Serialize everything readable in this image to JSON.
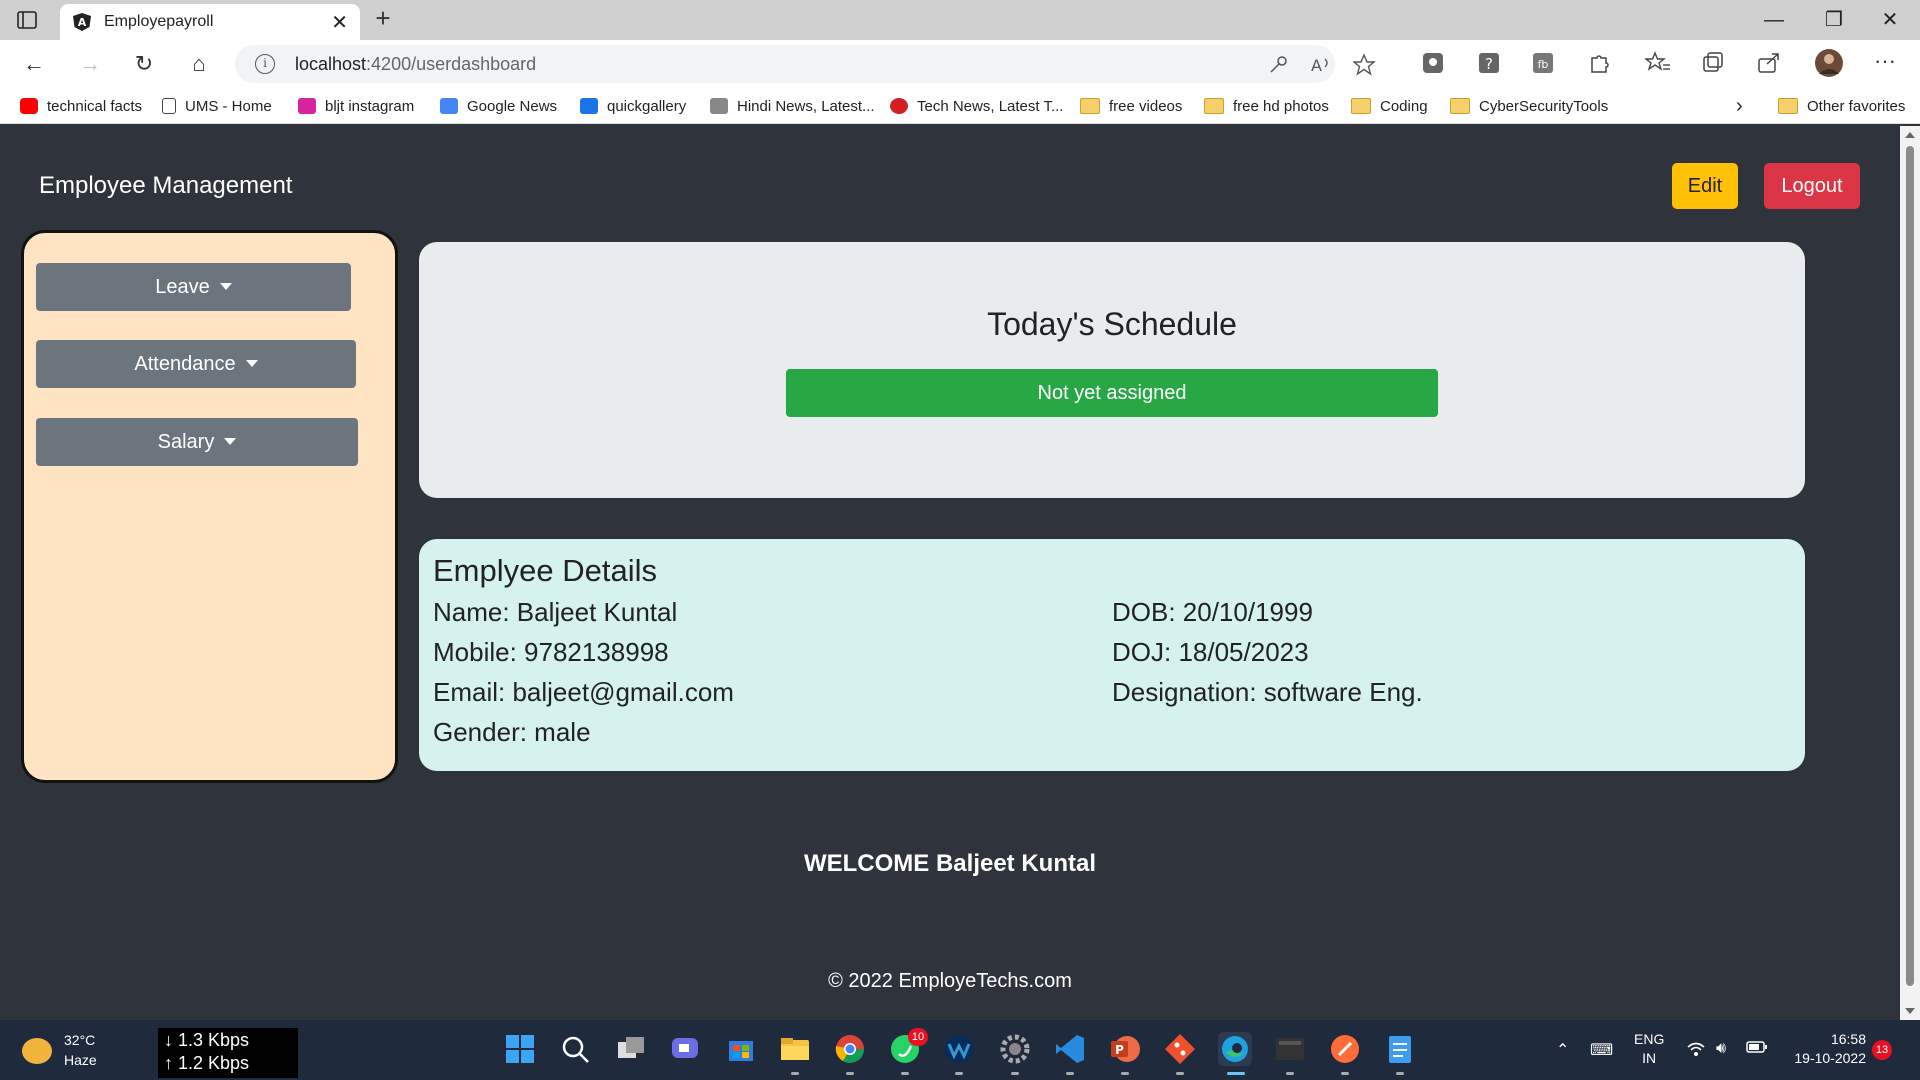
{
  "browser": {
    "tab_title": "Employepayroll",
    "url_host": "localhost",
    "url_path": ":4200/userdashboard",
    "bookmarks": [
      {
        "label": "technical facts",
        "icon": "youtube-icon",
        "color": "#ff0000"
      },
      {
        "label": "UMS - Home",
        "icon": "page-icon",
        "color": "#444444"
      },
      {
        "label": "bljt instagram",
        "icon": "instagram-icon",
        "color": "#d6249f"
      },
      {
        "label": "Google News",
        "icon": "google-news-icon",
        "color": "#4285f4"
      },
      {
        "label": "quickgallery",
        "icon": "camera-icon",
        "color": "#1a73e8"
      },
      {
        "label": "Hindi News, Latest...",
        "icon": "news-icon",
        "color": "#888888"
      },
      {
        "label": "Tech News, Latest T...",
        "icon": "tech-news-icon",
        "color": "#d12121"
      },
      {
        "label": "free videos",
        "icon": "folder-icon"
      },
      {
        "label": "free hd photos",
        "icon": "folder-icon"
      },
      {
        "label": "Coding",
        "icon": "folder-icon"
      },
      {
        "label": "CyberSecurityTools",
        "icon": "folder-icon"
      }
    ],
    "other_favorites": "Other favorites"
  },
  "app": {
    "brand": "Employee Management",
    "edit_label": "Edit",
    "logout_label": "Logout",
    "sidebar": {
      "items": [
        "Leave",
        "Attendance",
        "Salary"
      ]
    },
    "schedule": {
      "title": "Today's Schedule",
      "status": "Not yet assigned"
    },
    "details": {
      "heading": "Emplyee Details",
      "name": "Name: Baljeet Kuntal",
      "mobile": "Mobile: 9782138998",
      "email": "Email: baljeet@gmail.com",
      "gender": "Gender: male",
      "dob": "DOB: 20/10/1999",
      "doj": "DOJ: 18/05/2023",
      "designation": "Designation: software Eng."
    },
    "welcome": "WELCOME Baljeet Kuntal",
    "footer": "© 2022 EmployeTechs.com"
  },
  "taskbar": {
    "weather_temp": "32°C",
    "weather_text": "Haze",
    "net_down": "↓ 1.3 Kbps",
    "net_up": "↑ 1.2 Kbps",
    "whatsapp_badge": "10",
    "lang_1": "ENG",
    "lang_2": "IN",
    "time": "16:58",
    "date": "19-10-2022",
    "notifications": "13"
  },
  "colors": {
    "page_bg": "#2f333b",
    "sidebar_bg": "#ffe4c4",
    "edit_button": "#ffc107",
    "logout_button": "#dc3545",
    "status_green": "#28a745",
    "details_bg": "#d6f2ee",
    "schedule_bg": "#e9ecef"
  }
}
